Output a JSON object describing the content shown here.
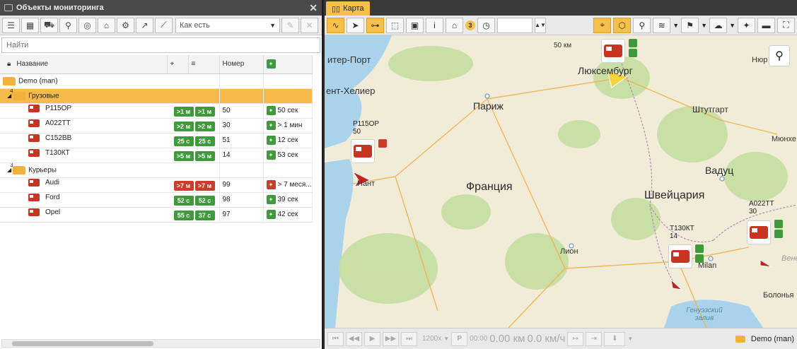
{
  "left_panel": {
    "title": "Объекты мониторинга",
    "mode_select": "Как есть",
    "search_placeholder": "Найти",
    "columns": {
      "name": "Название",
      "number": "Номер"
    },
    "root_group": "Demo (man)",
    "groups": [
      {
        "name": "Грузовые",
        "count": "4",
        "selected": true,
        "units": [
          {
            "name": "Р115ОР",
            "b1": ">1 м",
            "b2": ">1 м",
            "c1": "g",
            "c2": "g",
            "number": "50",
            "time": "50 сек",
            "tcolor": "g"
          },
          {
            "name": "А022ТТ",
            "b1": ">2 м",
            "b2": ">2 м",
            "c1": "g",
            "c2": "g",
            "number": "30",
            "time": "> 1 мин",
            "tcolor": "g"
          },
          {
            "name": "С152ВВ",
            "b1": "25 с",
            "b2": "25 с",
            "c1": "g",
            "c2": "g",
            "number": "51",
            "time": "12 сек",
            "tcolor": "g"
          },
          {
            "name": "Т130КТ",
            "b1": ">5 м",
            "b2": ">5 м",
            "c1": "g",
            "c2": "g",
            "number": "14",
            "time": "53 сек",
            "tcolor": "g"
          }
        ]
      },
      {
        "name": "Курьеры",
        "count": "3",
        "selected": false,
        "units": [
          {
            "name": "Audi",
            "b1": ">7 м",
            "b2": ">7 м",
            "c1": "r",
            "c2": "r",
            "number": "99",
            "time": "> 7 меся...",
            "tcolor": "r"
          },
          {
            "name": "Ford",
            "b1": "52 с",
            "b2": "52 с",
            "c1": "g",
            "c2": "g",
            "number": "98",
            "time": "39 сек",
            "tcolor": "g"
          },
          {
            "name": "Opel",
            "b1": "55 с",
            "b2": "37 с",
            "c1": "g",
            "c2": "g",
            "number": "97",
            "time": "42 сек",
            "tcolor": "g"
          }
        ]
      }
    ]
  },
  "map_panel": {
    "tab": "Карта",
    "marker_count": "3",
    "scale": "50 км",
    "labels": {
      "spb": "итер-Порт",
      "st_helier": "ент-Хелиер",
      "lux": "Люксембург",
      "nur": "Нюр",
      "paris": "Париж",
      "stuttgart": "Штутгарт",
      "munich": "Мюнхе",
      "france": "Франция",
      "vaduz": "Вадуц",
      "switzerland": "Швейцария",
      "nant": "Нант",
      "lyon": "Лион",
      "milan": "Milan",
      "bologna": "Болонья",
      "genoa": "Генуэзский залив",
      "venice": "Вене"
    },
    "units": [
      {
        "name": "Р115ОР",
        "number": "50"
      },
      {
        "name": "Т130КТ",
        "number": "14"
      },
      {
        "name": "А022ТТ",
        "number": "30"
      }
    ],
    "player": {
      "speed": "1200x",
      "p": "P",
      "time": "00:00",
      "dist": "0.00 км",
      "velocity": "0.0 км/ч",
      "group": "Demo (man)"
    }
  }
}
